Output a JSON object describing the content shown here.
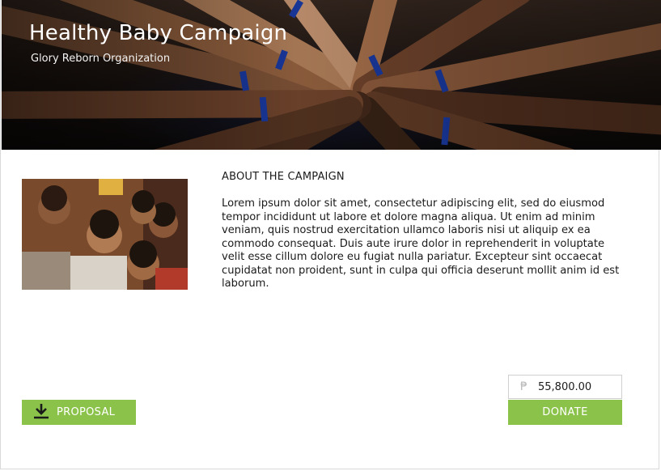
{
  "hero": {
    "title": "Healthy Baby Campaign",
    "subtitle": "Glory Reborn Organization"
  },
  "about": {
    "heading": "ABOUT THE CAMPAIGN",
    "body": "Lorem ipsum dolor sit amet, consectetur adipiscing elit, sed do eiusmod tempor incididunt ut labore et dolore magna aliqua. Ut enim ad minim veniam, quis nostrud exercitation ullamco laboris nisi ut aliquip ex ea commodo consequat. Duis aute irure dolor in reprehenderit in voluptate velit esse cillum dolore eu fugiat nulla pariatur. Excepteur sint occaecat cupidatat non proident, sunt in culpa qui officia deserunt mollit anim id est laborum."
  },
  "actions": {
    "proposal_label": "PROPOSAL",
    "donate_label": "DONATE",
    "currency_symbol": "₱",
    "amount_value": "55,800.00"
  },
  "icons": {
    "download": "download-icon",
    "currency": "peso-icon"
  },
  "colors": {
    "accent": "#8bc34a",
    "text": "#1b1b1b"
  }
}
